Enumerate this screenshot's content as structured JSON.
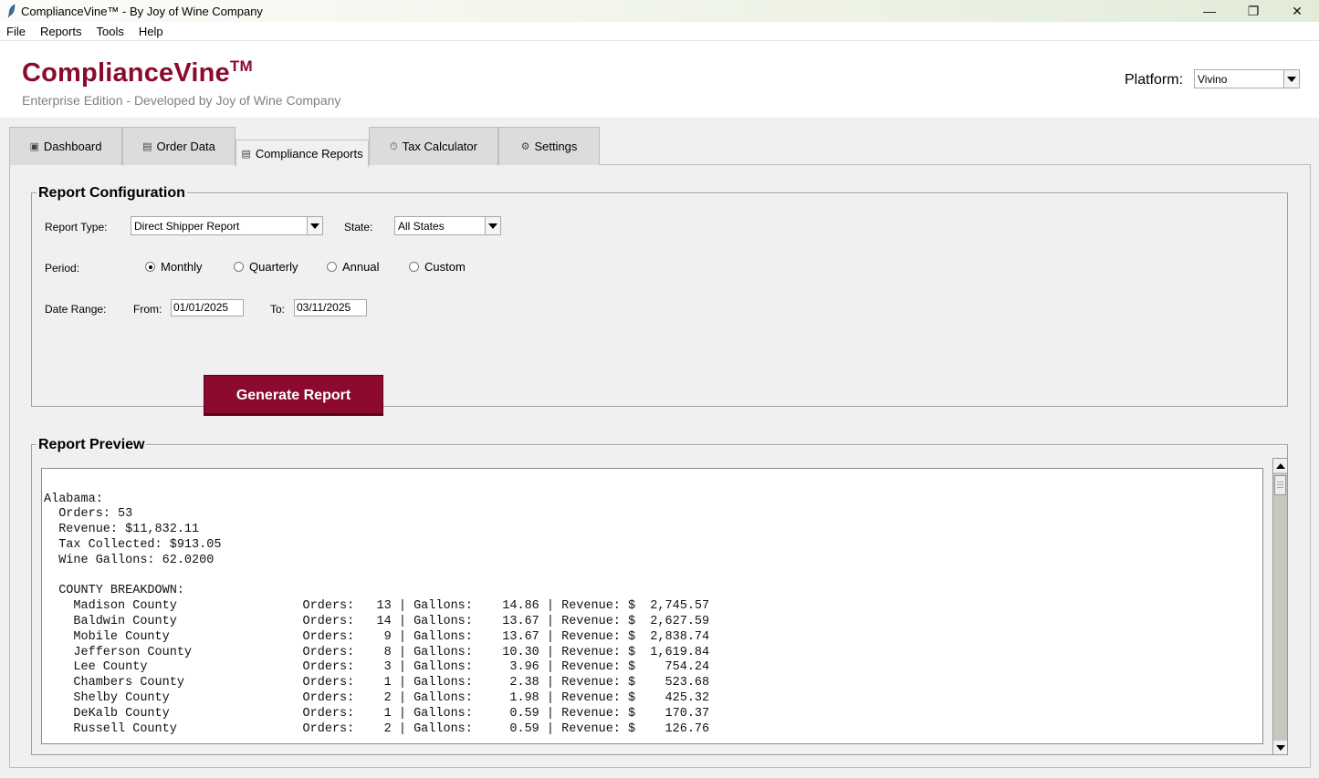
{
  "window": {
    "title": "ComplianceVine™ - By Joy of Wine Company",
    "minimize_glyph": "—",
    "restore_glyph": "❐",
    "close_glyph": "✕"
  },
  "menu": [
    "File",
    "Reports",
    "Tools",
    "Help"
  ],
  "header": {
    "brand": "ComplianceVine",
    "brand_mark": "TM",
    "subtitle": "Enterprise Edition - Developed by Joy of Wine Company",
    "platform_label": "Platform:",
    "platform_value": "Vivino"
  },
  "tabs": [
    {
      "label": "Dashboard",
      "icon": "dashboard-icon",
      "glyph": "▣"
    },
    {
      "label": "Order Data",
      "icon": "order-data-icon",
      "glyph": "▤"
    },
    {
      "label": "Compliance Reports",
      "icon": "compliance-reports-icon",
      "glyph": "▤"
    },
    {
      "label": "Tax Calculator",
      "icon": "tax-calculator-icon",
      "glyph": "⏱"
    },
    {
      "label": "Settings",
      "icon": "settings-gear-icon",
      "glyph": "⚙"
    }
  ],
  "active_tab": "Compliance Reports",
  "config": {
    "title": "Report Configuration",
    "report_type_label": "Report Type:",
    "report_type_value": "Direct Shipper Report",
    "state_label": "State:",
    "state_value": "All States",
    "period_label": "Period:",
    "periods": [
      "Monthly",
      "Quarterly",
      "Annual",
      "Custom"
    ],
    "selected_period": "Monthly",
    "date_range_label": "Date Range:",
    "from_label": "From:",
    "from_value": "01/01/2025",
    "to_label": "To:",
    "to_value": "03/11/2025",
    "generate_label": "Generate Report"
  },
  "preview": {
    "title": "Report Preview",
    "text": "----------------------------------------\n\nAlabama:\n  Orders: 53\n  Revenue: $11,832.11\n  Tax Collected: $913.05\n  Wine Gallons: 62.0200\n\n  COUNTY BREAKDOWN:\n    Madison County                 Orders:   13 | Gallons:    14.86 | Revenue: $  2,745.57\n    Baldwin County                 Orders:   14 | Gallons:    13.67 | Revenue: $  2,627.59\n    Mobile County                  Orders:    9 | Gallons:    13.67 | Revenue: $  2,838.74\n    Jefferson County               Orders:    8 | Gallons:    10.30 | Revenue: $  1,619.84\n    Lee County                     Orders:    3 | Gallons:     3.96 | Revenue: $    754.24\n    Chambers County                Orders:    1 | Gallons:     2.38 | Revenue: $    523.68\n    Shelby County                  Orders:    2 | Gallons:     1.98 | Revenue: $    425.32\n    DeKalb County                  Orders:    1 | Gallons:     0.59 | Revenue: $    170.37\n    Russell County                 Orders:    2 | Gallons:     0.59 | Revenue: $    126.76"
  }
}
